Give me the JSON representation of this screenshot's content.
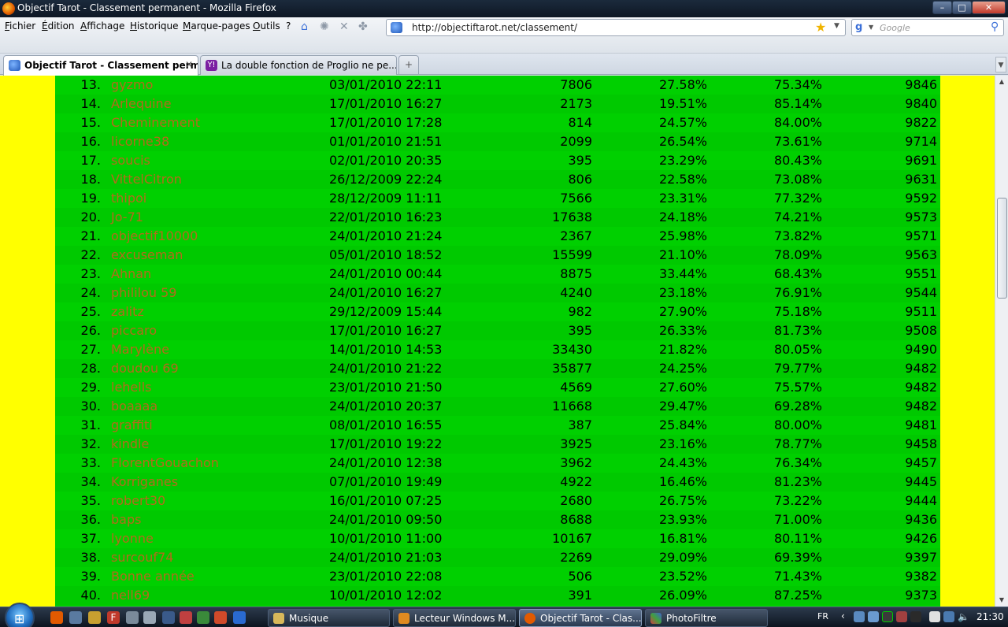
{
  "window": {
    "title": "Objectif Tarot - Classement permanent - Mozilla Firefox",
    "minimize": "–",
    "maximize": "□",
    "close": "✕"
  },
  "menu": [
    "Fichier",
    "Édition",
    "Affichage",
    "Historique",
    "Marque-pages",
    "Outils",
    "?"
  ],
  "address_bar": {
    "url": "http://objectiftarot.net/classement/"
  },
  "search_bar": {
    "placeholder": "Google"
  },
  "tabs": [
    {
      "label": "Objectif Tarot - Classement perm...",
      "active": true
    },
    {
      "label": "La double fonction de Proglio ne pe...",
      "active": false
    }
  ],
  "ranking": [
    {
      "rank": "13.",
      "name": "gyzmo",
      "date": "03/01/2010 22:11",
      "games": "7806",
      "pct1": "27.58%",
      "pct2": "75.34%",
      "score": "9846"
    },
    {
      "rank": "14.",
      "name": "Arlequine",
      "date": "17/01/2010 16:27",
      "games": "2173",
      "pct1": "19.51%",
      "pct2": "85.14%",
      "score": "9840"
    },
    {
      "rank": "15.",
      "name": "Cheminement",
      "date": "17/01/2010 17:28",
      "games": "814",
      "pct1": "24.57%",
      "pct2": "84.00%",
      "score": "9822"
    },
    {
      "rank": "16.",
      "name": "licorne38",
      "date": "01/01/2010 21:51",
      "games": "2099",
      "pct1": "26.54%",
      "pct2": "73.61%",
      "score": "9714"
    },
    {
      "rank": "17.",
      "name": "soucis",
      "date": "02/01/2010 20:35",
      "games": "395",
      "pct1": "23.29%",
      "pct2": "80.43%",
      "score": "9691"
    },
    {
      "rank": "18.",
      "name": "VittelCitron",
      "date": "26/12/2009 22:24",
      "games": "806",
      "pct1": "22.58%",
      "pct2": "73.08%",
      "score": "9631"
    },
    {
      "rank": "19.",
      "name": "thipoi",
      "date": "28/12/2009 11:11",
      "games": "7566",
      "pct1": "23.31%",
      "pct2": "77.32%",
      "score": "9592"
    },
    {
      "rank": "20.",
      "name": "Jo-71",
      "date": "22/01/2010 16:23",
      "games": "17638",
      "pct1": "24.18%",
      "pct2": "74.21%",
      "score": "9573"
    },
    {
      "rank": "21.",
      "name": "objectif10000",
      "date": "24/01/2010 21:24",
      "games": "2367",
      "pct1": "25.98%",
      "pct2": "73.82%",
      "score": "9571"
    },
    {
      "rank": "22.",
      "name": "excuseman",
      "date": "05/01/2010 18:52",
      "games": "15599",
      "pct1": "21.10%",
      "pct2": "78.09%",
      "score": "9563"
    },
    {
      "rank": "23.",
      "name": "Ahnan",
      "date": "24/01/2010 00:44",
      "games": "8875",
      "pct1": "33.44%",
      "pct2": "68.43%",
      "score": "9551"
    },
    {
      "rank": "24.",
      "name": "phililou 59",
      "date": "24/01/2010 16:27",
      "games": "4240",
      "pct1": "23.18%",
      "pct2": "76.91%",
      "score": "9544"
    },
    {
      "rank": "25.",
      "name": "zalitz",
      "date": "29/12/2009 15:44",
      "games": "982",
      "pct1": "27.90%",
      "pct2": "75.18%",
      "score": "9511"
    },
    {
      "rank": "26.",
      "name": "piccaro",
      "date": "17/01/2010 16:27",
      "games": "395",
      "pct1": "26.33%",
      "pct2": "81.73%",
      "score": "9508"
    },
    {
      "rank": "27.",
      "name": "Marylène",
      "date": "14/01/2010 14:53",
      "games": "33430",
      "pct1": "21.82%",
      "pct2": "80.05%",
      "score": "9490"
    },
    {
      "rank": "28.",
      "name": "doudou 69",
      "date": "24/01/2010 21:22",
      "games": "35877",
      "pct1": "24.25%",
      "pct2": "79.77%",
      "score": "9482"
    },
    {
      "rank": "29.",
      "name": "lehells",
      "date": "23/01/2010 21:50",
      "games": "4569",
      "pct1": "27.60%",
      "pct2": "75.57%",
      "score": "9482"
    },
    {
      "rank": "30.",
      "name": "boaaaa",
      "date": "24/01/2010 20:37",
      "games": "11668",
      "pct1": "29.47%",
      "pct2": "69.28%",
      "score": "9482"
    },
    {
      "rank": "31.",
      "name": "graffiti",
      "date": "08/01/2010 16:55",
      "games": "387",
      "pct1": "25.84%",
      "pct2": "80.00%",
      "score": "9481"
    },
    {
      "rank": "32.",
      "name": "kindle",
      "date": "17/01/2010 19:22",
      "games": "3925",
      "pct1": "23.16%",
      "pct2": "78.77%",
      "score": "9458"
    },
    {
      "rank": "33.",
      "name": "FlorentGouachon",
      "date": "24/01/2010 12:38",
      "games": "3962",
      "pct1": "24.43%",
      "pct2": "76.34%",
      "score": "9457"
    },
    {
      "rank": "34.",
      "name": "Korriganes",
      "date": "07/01/2010 19:49",
      "games": "4922",
      "pct1": "16.46%",
      "pct2": "81.23%",
      "score": "9445"
    },
    {
      "rank": "35.",
      "name": "robert30",
      "date": "16/01/2010 07:25",
      "games": "2680",
      "pct1": "26.75%",
      "pct2": "73.22%",
      "score": "9444"
    },
    {
      "rank": "36.",
      "name": "baps",
      "date": "24/01/2010 09:50",
      "games": "8688",
      "pct1": "23.93%",
      "pct2": "71.00%",
      "score": "9436"
    },
    {
      "rank": "37.",
      "name": "lyonne",
      "date": "10/01/2010 11:00",
      "games": "10167",
      "pct1": "16.81%",
      "pct2": "80.11%",
      "score": "9426"
    },
    {
      "rank": "38.",
      "name": "surcouf74",
      "date": "24/01/2010 21:03",
      "games": "2269",
      "pct1": "29.09%",
      "pct2": "69.39%",
      "score": "9397"
    },
    {
      "rank": "39.",
      "name": "Bonne année",
      "date": "23/01/2010 22:08",
      "games": "506",
      "pct1": "23.52%",
      "pct2": "71.43%",
      "score": "9382"
    },
    {
      "rank": "40.",
      "name": "nell69",
      "date": "10/01/2010 12:02",
      "games": "391",
      "pct1": "26.09%",
      "pct2": "87.25%",
      "score": "9373"
    }
  ],
  "scroll": {
    "position_fraction": 0.27
  },
  "taskbar": {
    "buttons": [
      {
        "label": "Musique",
        "active": false
      },
      {
        "label": "Lecteur Windows M...",
        "active": false
      },
      {
        "label": "Objectif Tarot - Clas...",
        "active": true
      },
      {
        "label": "PhotoFiltre",
        "active": false
      }
    ],
    "language": "FR",
    "clock": "21:30"
  },
  "colors": {
    "page_bg": "#ffff00",
    "table_bg": "#00d000",
    "name_link": "#b46a1c"
  }
}
